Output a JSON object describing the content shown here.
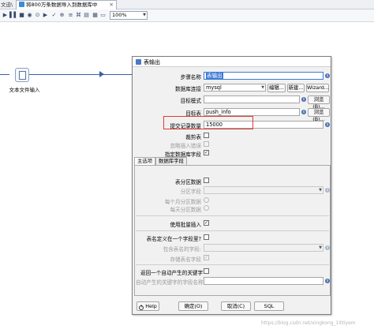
{
  "tabs": {
    "edge_label": "文迫\\",
    "active_label": "将800万条数据导入到数据库中",
    "close_glyph": "✕"
  },
  "toolbar": {
    "zoom_value": "100%",
    "icons": [
      "play-icon",
      "pause-icon",
      "stop-icon",
      "preview-icon",
      "debug-icon",
      "replay-icon",
      "verify-icon",
      "impact-icon",
      "sql-icon",
      "explore-icon",
      "results-icon",
      "grid-icon",
      "layout-icon"
    ]
  },
  "canvas": {
    "step_label": "文本文件输入"
  },
  "dialog": {
    "title": "表输出",
    "fields": {
      "step_name_label": "步骤名称",
      "step_name_value": "表输出",
      "connection_label": "数据库连接",
      "connection_value": "mysql",
      "edit_button": "编辑...",
      "new_button": "新建...",
      "wizard_button": "Wizard...",
      "schema_label": "目标模式",
      "schema_value": "",
      "browse_button": "浏览(B)...",
      "table_label": "目标表",
      "table_value": "push_info",
      "browse2_button": "浏览(B)...",
      "commit_label": "提交记录数量",
      "commit_value": "15000",
      "truncate_label": "裁剪表",
      "ignore_errors_label": "忽略插入错误",
      "specify_fields_label": "指定数据库字段"
    },
    "tabs": [
      "主选项",
      "数据库字段"
    ],
    "options": {
      "partition_label": "表分区数据",
      "partition_field_label": "分区字段",
      "partition_month_label": "每个月分区数据",
      "partition_day_label": "每天分区数据",
      "batch_insert_label": "使用批量插入",
      "name_in_field_label": "表名定义在一个字段里?",
      "name_field_label": "包含表名的字段:",
      "store_name_label": "存储表名字段",
      "return_key_label": "返回一个自动产生的关键字",
      "key_field_label": "自动产生的关键字的字段名称"
    },
    "buttons": {
      "help": "Help",
      "ok": "确定(O)",
      "cancel": "取消(C)",
      "sql": "SQL"
    }
  },
  "watermark": "https://blog.csdn.net/xingkong_1ittiyem",
  "colors": {
    "highlight": "#e23b2f",
    "hop": "#3b5ea8",
    "selection": "#3d7ad6"
  }
}
